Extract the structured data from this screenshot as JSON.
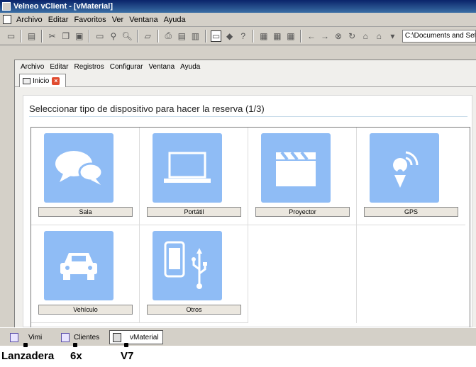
{
  "window": {
    "title": "Velneo vClient - [vMaterial]"
  },
  "menubar": {
    "items": [
      "Archivo",
      "Editar",
      "Favoritos",
      "Ver",
      "Ventana",
      "Ayuda"
    ]
  },
  "toolbar": {
    "path": "C:\\Documents and Settings"
  },
  "inner_menu": {
    "items": [
      "Archivo",
      "Editar",
      "Registros",
      "Configurar",
      "Ventana",
      "Ayuda"
    ]
  },
  "tab": {
    "label": "Inicio"
  },
  "panel": {
    "title": "Seleccionar tipo de dispositivo para hacer la reserva (1/3)"
  },
  "devices": [
    {
      "label": "Sala",
      "icon": "chat-bubbles-icon"
    },
    {
      "label": "Portátil",
      "icon": "laptop-icon"
    },
    {
      "label": "Proyector",
      "icon": "clapperboard-icon"
    },
    {
      "label": "GPS",
      "icon": "gps-pin-icon"
    },
    {
      "label": "Vehículo",
      "icon": "car-icon"
    },
    {
      "label": "Otros",
      "icon": "phone-usb-icon"
    }
  ],
  "taskbar": {
    "buttons": [
      {
        "label": "Vimi"
      },
      {
        "label": "Clientes"
      },
      {
        "label": "vMaterial"
      }
    ]
  },
  "annotations": [
    "Lanzadera",
    "6x",
    "V7"
  ],
  "colors": {
    "tile": "#8fbcf5",
    "titlebar": "#0a246a",
    "caption_bg": "#ebe7df"
  }
}
